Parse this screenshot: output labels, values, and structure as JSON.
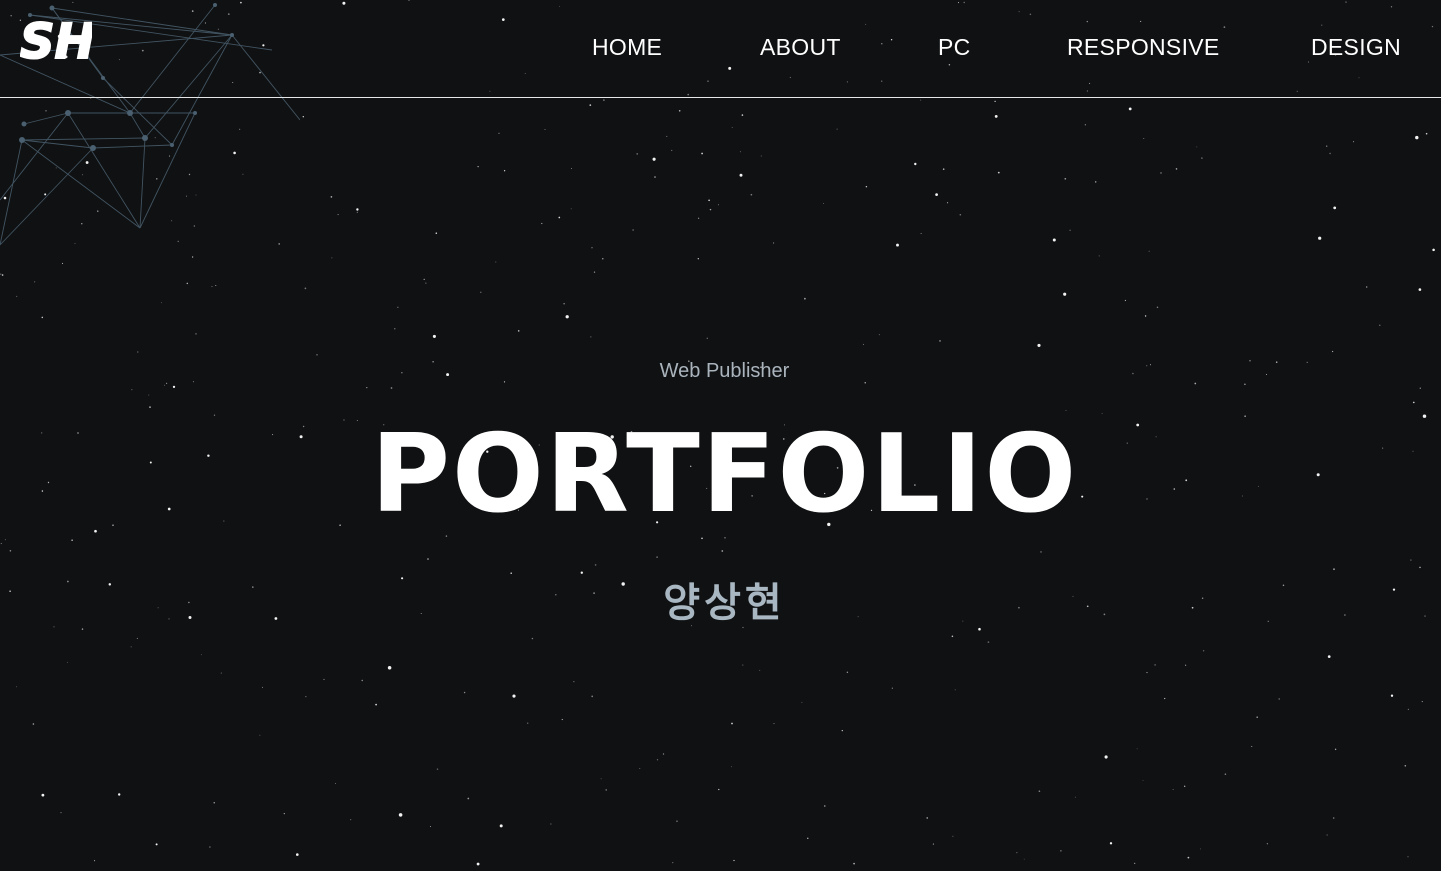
{
  "header": {
    "logo_text": "SH",
    "nav": [
      {
        "label": "HOME"
      },
      {
        "label": "ABOUT"
      },
      {
        "label": "PC"
      },
      {
        "label": "RESPONSIVE"
      },
      {
        "label": "DESIGN"
      }
    ]
  },
  "hero": {
    "subtitle": "Web Publisher",
    "title": "PORTFOLIO",
    "name": "양상현"
  },
  "colors": {
    "background": "#101112",
    "text": "#ffffff",
    "subtitle": "#aab4bd",
    "name": "#a9b7c2",
    "network_lines": "#4a6070"
  }
}
